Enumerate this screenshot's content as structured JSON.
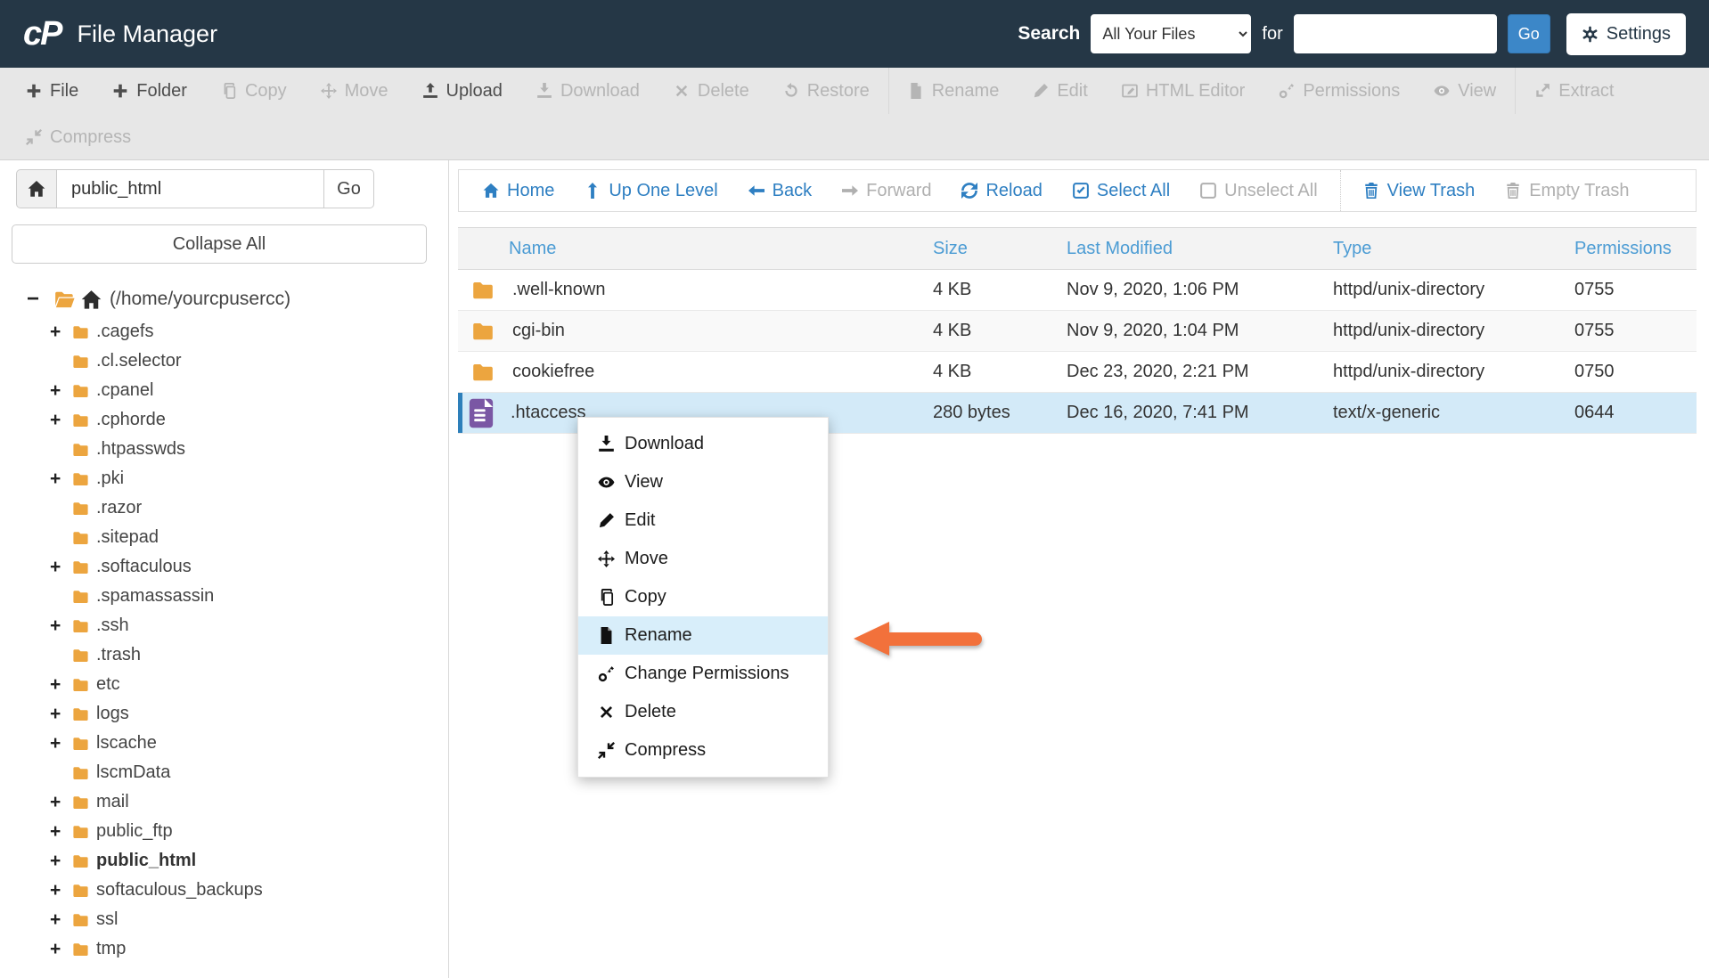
{
  "header": {
    "logo": "cP",
    "title": "File Manager",
    "search_label": "Search",
    "scope_select": {
      "selected": "All Your Files"
    },
    "for_label": "for",
    "search_input": {
      "value": "",
      "placeholder": ""
    },
    "go_button": "Go",
    "settings_button": "Settings",
    "settings_icon": "gear"
  },
  "toolbar": {
    "items": [
      {
        "label": "File",
        "icon": "plus",
        "enabled": true
      },
      {
        "label": "Folder",
        "icon": "plus",
        "enabled": true
      },
      {
        "label": "Copy",
        "icon": "copy",
        "enabled": false
      },
      {
        "label": "Move",
        "icon": "move",
        "enabled": false
      },
      {
        "label": "Upload",
        "icon": "upload",
        "enabled": true
      },
      {
        "label": "Download",
        "icon": "download",
        "enabled": false
      },
      {
        "label": "Delete",
        "icon": "x",
        "enabled": false
      },
      {
        "label": "Restore",
        "icon": "restore",
        "enabled": false
      },
      {
        "label": "Rename",
        "icon": "file",
        "enabled": false
      },
      {
        "label": "Edit",
        "icon": "pencil",
        "enabled": false
      },
      {
        "label": "HTML Editor",
        "icon": "html-editor",
        "enabled": false
      },
      {
        "label": "Permissions",
        "icon": "key",
        "enabled": false
      },
      {
        "label": "View",
        "icon": "eye",
        "enabled": false
      },
      {
        "label": "Extract",
        "icon": "extract",
        "enabled": false
      },
      {
        "label": "Compress",
        "icon": "compress",
        "enabled": false
      }
    ]
  },
  "sidebar": {
    "home_icon": "home",
    "path_input": {
      "value": "public_html"
    },
    "go_button": "Go",
    "collapse_all_button": "Collapse All",
    "root": {
      "expander": "−",
      "icon": "folder-open",
      "home_icon": "home",
      "label": "(/home/yourcpusercc)"
    },
    "tree": [
      {
        "expander": "+",
        "icon": "folder",
        "label": ".cagefs"
      },
      {
        "expander": "",
        "icon": "folder",
        "label": ".cl.selector"
      },
      {
        "expander": "+",
        "icon": "folder",
        "label": ".cpanel"
      },
      {
        "expander": "+",
        "icon": "folder",
        "label": ".cphorde"
      },
      {
        "expander": "",
        "icon": "folder",
        "label": ".htpasswds"
      },
      {
        "expander": "+",
        "icon": "folder",
        "label": ".pki"
      },
      {
        "expander": "",
        "icon": "folder",
        "label": ".razor"
      },
      {
        "expander": "",
        "icon": "folder",
        "label": ".sitepad"
      },
      {
        "expander": "+",
        "icon": "folder",
        "label": ".softaculous"
      },
      {
        "expander": "",
        "icon": "folder",
        "label": ".spamassassin"
      },
      {
        "expander": "+",
        "icon": "folder",
        "label": ".ssh"
      },
      {
        "expander": "",
        "icon": "folder",
        "label": ".trash"
      },
      {
        "expander": "+",
        "icon": "folder",
        "label": "etc"
      },
      {
        "expander": "+",
        "icon": "folder",
        "label": "logs"
      },
      {
        "expander": "+",
        "icon": "folder",
        "label": "lscache"
      },
      {
        "expander": "",
        "icon": "folder",
        "label": "lscmData"
      },
      {
        "expander": "+",
        "icon": "folder",
        "label": "mail"
      },
      {
        "expander": "+",
        "icon": "folder",
        "label": "public_ftp"
      },
      {
        "expander": "+",
        "icon": "folder",
        "label": "public_html",
        "current": true
      },
      {
        "expander": "+",
        "icon": "folder",
        "label": "softaculous_backups"
      },
      {
        "expander": "+",
        "icon": "folder",
        "label": "ssl"
      },
      {
        "expander": "+",
        "icon": "folder",
        "label": "tmp"
      }
    ]
  },
  "nav": {
    "items": [
      {
        "label": "Home",
        "icon": "home",
        "enabled": true
      },
      {
        "label": "Up One Level",
        "icon": "up",
        "enabled": true
      },
      {
        "label": "Back",
        "icon": "back",
        "enabled": true
      },
      {
        "label": "Forward",
        "icon": "forward",
        "enabled": false
      },
      {
        "label": "Reload",
        "icon": "reload",
        "enabled": true
      },
      {
        "label": "Select All",
        "icon": "check-square",
        "enabled": true
      },
      {
        "label": "Unselect All",
        "icon": "square",
        "enabled": false
      },
      {
        "label": "View Trash",
        "icon": "trash",
        "enabled": true
      },
      {
        "label": "Empty Trash",
        "icon": "trash",
        "enabled": false
      }
    ]
  },
  "table": {
    "columns": [
      "Name",
      "Size",
      "Last Modified",
      "Type",
      "Permissions"
    ],
    "rows": [
      {
        "icon": "folder",
        "name": ".well-known",
        "size": "4 KB",
        "modified": "Nov 9, 2020, 1:06 PM",
        "type": "httpd/unix-directory",
        "permissions": "0755",
        "selected": false
      },
      {
        "icon": "folder",
        "name": "cgi-bin",
        "size": "4 KB",
        "modified": "Nov 9, 2020, 1:04 PM",
        "type": "httpd/unix-directory",
        "permissions": "0755",
        "selected": false
      },
      {
        "icon": "folder",
        "name": "cookiefree",
        "size": "4 KB",
        "modified": "Dec 23, 2020, 2:21 PM",
        "type": "httpd/unix-directory",
        "permissions": "0750",
        "selected": false
      },
      {
        "icon": "file-purple",
        "name": ".htaccess",
        "size": "280 bytes",
        "modified": "Dec 16, 2020, 7:41 PM",
        "type": "text/x-generic",
        "permissions": "0644",
        "selected": true
      }
    ]
  },
  "context_menu": {
    "items": [
      {
        "label": "Download",
        "icon": "download",
        "highlighted": false
      },
      {
        "label": "View",
        "icon": "eye",
        "highlighted": false
      },
      {
        "label": "Edit",
        "icon": "pencil",
        "highlighted": false
      },
      {
        "label": "Move",
        "icon": "move",
        "highlighted": false
      },
      {
        "label": "Copy",
        "icon": "copy",
        "highlighted": false
      },
      {
        "label": "Rename",
        "icon": "file",
        "highlighted": true
      },
      {
        "label": "Change Permissions",
        "icon": "key",
        "highlighted": false
      },
      {
        "label": "Delete",
        "icon": "x",
        "highlighted": false
      },
      {
        "label": "Compress",
        "icon": "compress",
        "highlighted": false
      }
    ]
  },
  "colors": {
    "header_bg": "#253746",
    "toolbar_bg": "#e7e7e7",
    "link_blue": "#2e7fc2",
    "table_header_blue": "#4c9cd4",
    "selected_row_bg": "#d3eaf8",
    "selected_row_bar": "#2d7fba",
    "folder_orange": "#eca53f",
    "file_purple": "#7a57a4",
    "primary_button_blue": "#3c87c8",
    "arrow_orange": "#f2713b"
  }
}
